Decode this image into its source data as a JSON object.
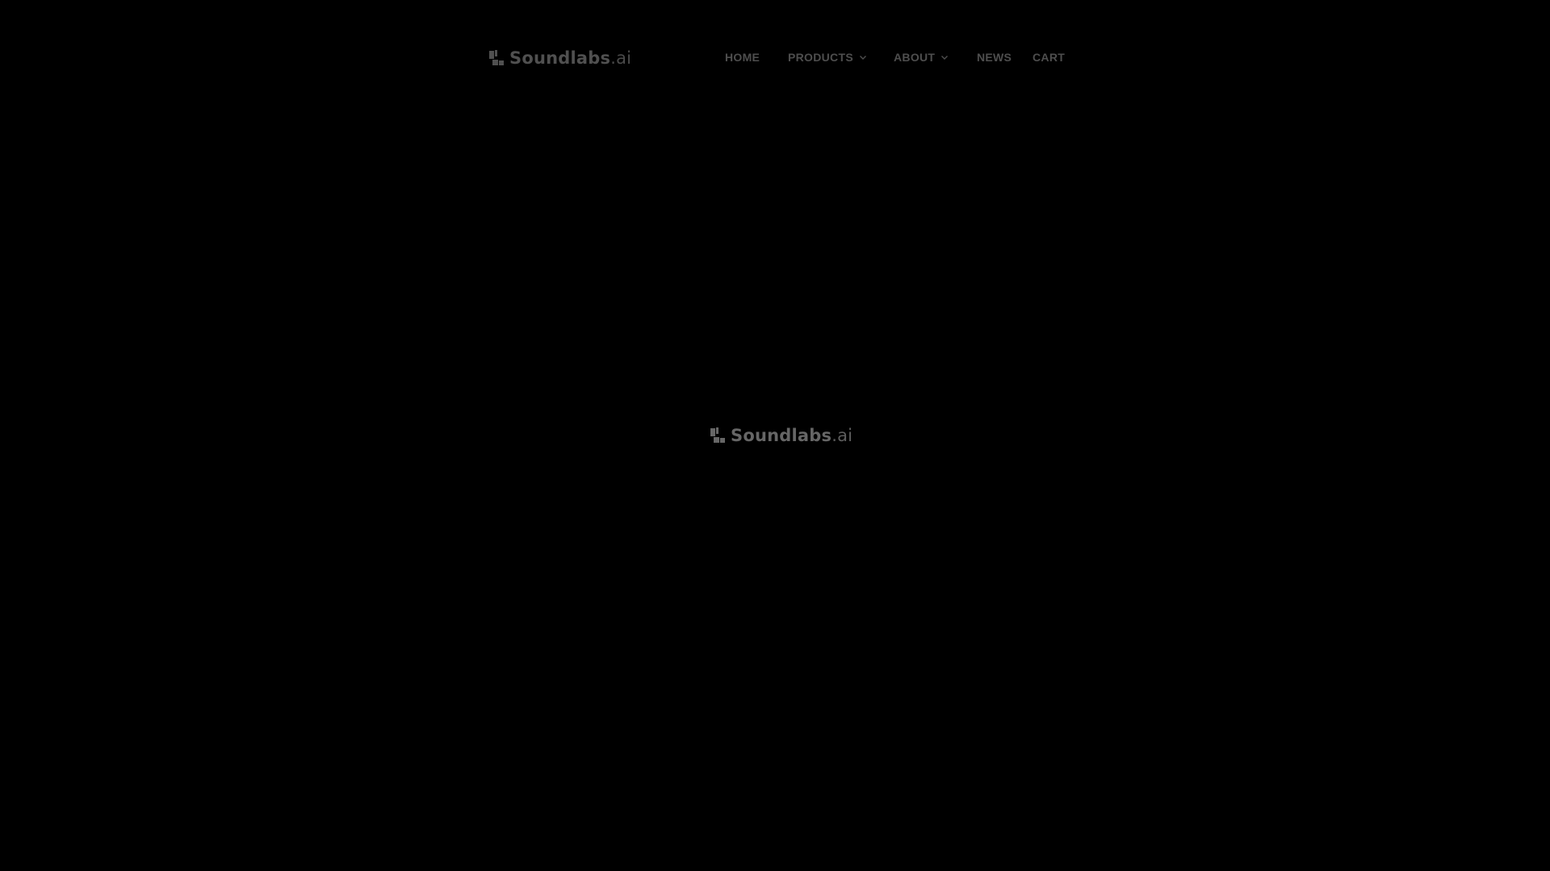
{
  "header": {
    "logo": {
      "name": "Soundlabs",
      "tld": ".ai"
    },
    "nav": {
      "home": "HOME",
      "products": "PRODUCTS",
      "about": "ABOUT",
      "news": "NEWS",
      "cart": "CART"
    }
  },
  "splash": {
    "name": "Soundlabs",
    "tld": ".ai"
  },
  "colors": {
    "background": "#000000",
    "header_text": "#4e4e4e",
    "splash_text": "#666666"
  }
}
